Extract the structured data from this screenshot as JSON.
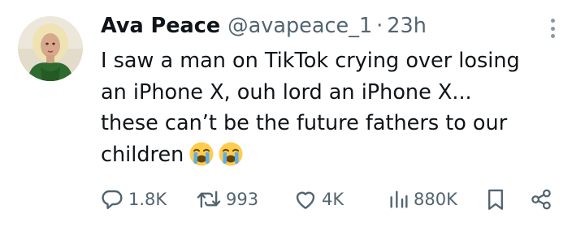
{
  "user": {
    "display_name": "Ava Peace",
    "handle": "@avapeace_1",
    "separator": "·",
    "time": "23h"
  },
  "tweet": {
    "lines": [
      "I saw a man on TikTok crying over losing",
      "an iPhone X, ouh lord an iPhone X...",
      "these can’t be the future fathers to our",
      "children"
    ],
    "emojis": [
      "loudly-crying-face",
      "loudly-crying-face"
    ]
  },
  "actions": {
    "replies": "1.8K",
    "retweets": "993",
    "likes": "4K",
    "views": "880K"
  },
  "icons": {
    "more": "more-vertical-icon",
    "reply": "reply-icon",
    "retweet": "retweet-icon",
    "like": "heart-icon",
    "views": "views-icon",
    "bookmark": "bookmark-icon",
    "share": "share-icon"
  },
  "colors": {
    "text": "#0f1419",
    "secondary": "#536471",
    "avatar_outfit": "#2e6b2e",
    "avatar_hair": "#efe3b4"
  }
}
